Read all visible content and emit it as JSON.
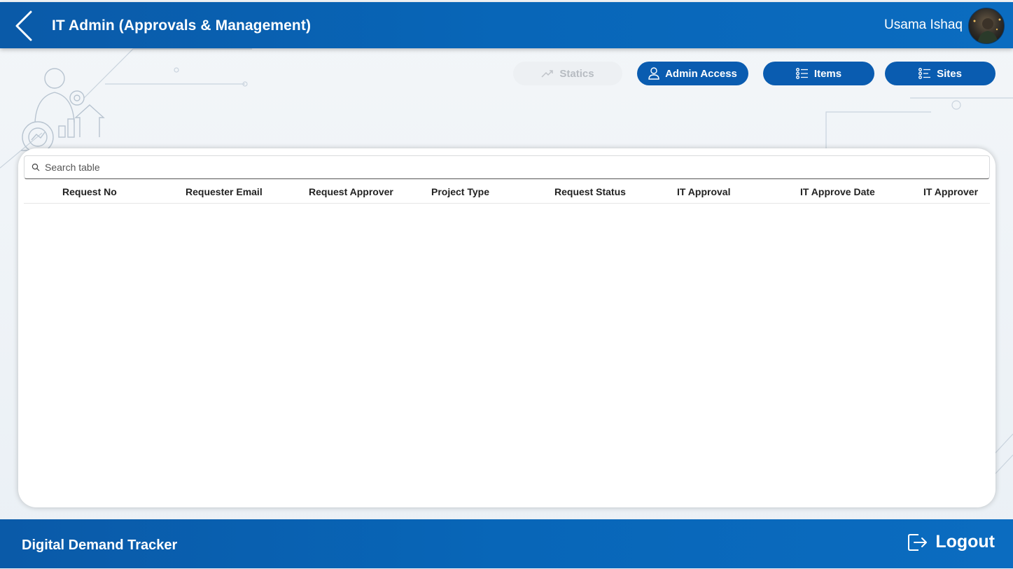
{
  "header": {
    "title": "IT Admin (Approvals & Management)",
    "user_name": "Usama Ishaq"
  },
  "toolbar": {
    "statics_label": "Statics",
    "statics_icon": "trend-up-icon",
    "admin_access_label": "Admin Access",
    "admin_access_icon": "person-icon",
    "items_label": "Items",
    "items_icon": "list-icon",
    "sites_label": "Sites",
    "sites_icon": "list-icon"
  },
  "table": {
    "search_placeholder": "Search table",
    "columns": [
      "Request No",
      "Requester Email",
      "Request Approver",
      "Project Type",
      "Request Status",
      "IT Approval",
      "IT Approve Date",
      "IT Approver"
    ],
    "rows": []
  },
  "footer": {
    "app_name": "Digital Demand Tracker",
    "logout_label": "Logout"
  },
  "colors": {
    "brand_blue": "#0a5cb0",
    "header_blue": "#0866b8",
    "disabled_bg": "#edf0f3",
    "disabled_text": "#b7bcc2"
  }
}
